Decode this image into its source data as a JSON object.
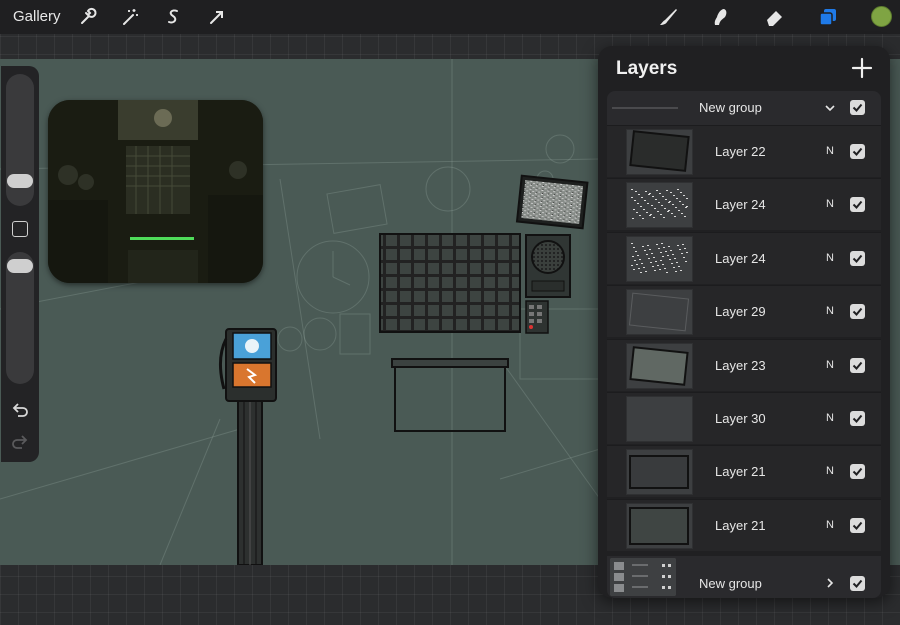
{
  "toolbar": {
    "gallery_label": "Gallery",
    "left_tools": [
      "wrench-icon",
      "magic-wand-icon",
      "selection-icon",
      "transform-arrow-icon"
    ],
    "right_tools": [
      "brush-icon",
      "smudge-icon",
      "eraser-icon",
      "layers-icon"
    ],
    "active_color": "#7fa443",
    "layers_active_color": "#1f7ae8"
  },
  "sidebar": {
    "items": [
      "brush-size-slider",
      "modify-button",
      "opacity-slider",
      "undo-icon",
      "redo-icon"
    ]
  },
  "layers_panel": {
    "title": "Layers",
    "add_icon": "plus-icon",
    "top_group": {
      "name": "New group",
      "visible": true
    },
    "layers": [
      {
        "name": "Layer 22",
        "mode": "N",
        "visible": true
      },
      {
        "name": "Layer 24",
        "mode": "N",
        "visible": true
      },
      {
        "name": "Layer 24",
        "mode": "N",
        "visible": true
      },
      {
        "name": "Layer 29",
        "mode": "N",
        "visible": true
      },
      {
        "name": "Layer 23",
        "mode": "N",
        "visible": true
      },
      {
        "name": "Layer 30",
        "mode": "N",
        "visible": true
      },
      {
        "name": "Layer 21",
        "mode": "N",
        "visible": true
      },
      {
        "name": "Layer 21",
        "mode": "N",
        "visible": true
      }
    ],
    "bottom_group": {
      "name": "New group",
      "visible": true
    }
  },
  "colors": {
    "canvas": "#4a5a55",
    "panel": "#202022",
    "accent": "#1f7ae8"
  }
}
